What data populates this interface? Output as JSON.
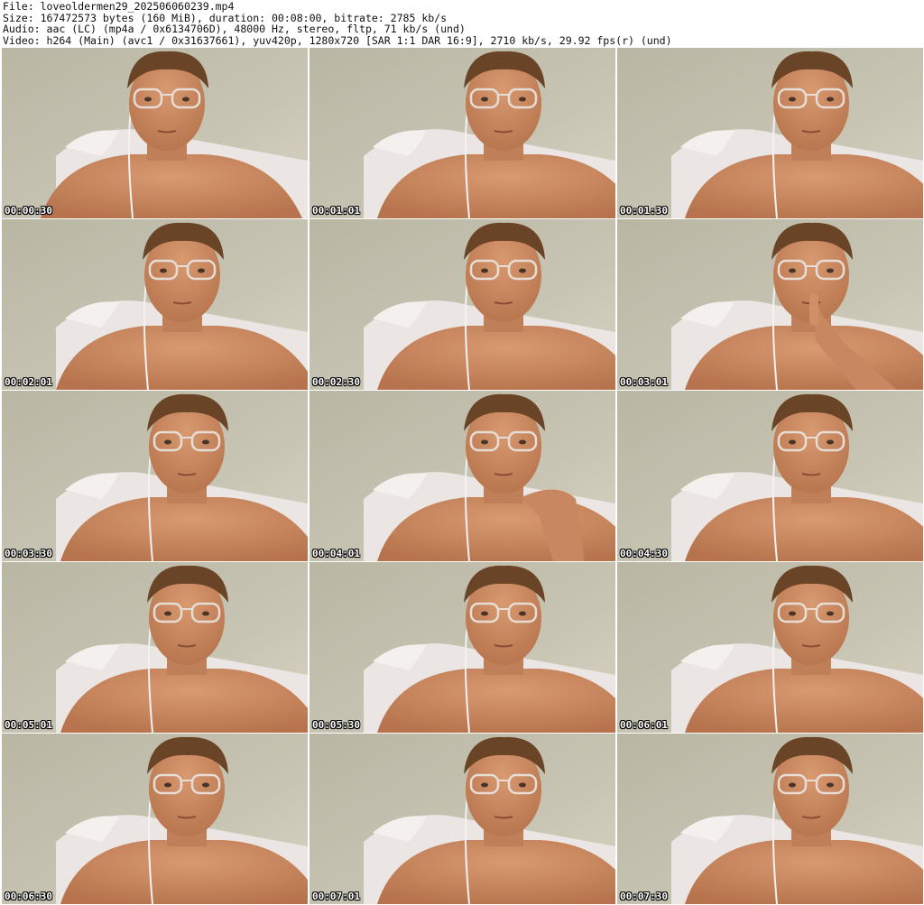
{
  "header": {
    "file_line": "File: loveoldermen29_202506060239.mp4",
    "size_line": "Size: 167472573 bytes (160 MiB), duration: 00:08:00, bitrate: 2785 kb/s",
    "audio_line": "Audio: aac (LC) (mp4a / 0x6134706D), 48000 Hz, stereo, fltp, 71 kb/s (und)",
    "video_line": "Video: h264 (Main) (avc1 / 0x31637661), yuv420p, 1280x720 [SAR 1:1 DAR 16:9], 2710 kb/s, 29.92 fps(r) (und)"
  },
  "thumbnails": [
    {
      "timestamp": "00:00:30"
    },
    {
      "timestamp": "00:01:01"
    },
    {
      "timestamp": "00:01:30"
    },
    {
      "timestamp": "00:02:01"
    },
    {
      "timestamp": "00:02:30"
    },
    {
      "timestamp": "00:03:01"
    },
    {
      "timestamp": "00:03:30"
    },
    {
      "timestamp": "00:04:01"
    },
    {
      "timestamp": "00:04:30"
    },
    {
      "timestamp": "00:05:01"
    },
    {
      "timestamp": "00:05:30"
    },
    {
      "timestamp": "00:06:01"
    },
    {
      "timestamp": "00:06:30"
    },
    {
      "timestamp": "00:07:01"
    },
    {
      "timestamp": "00:07:30"
    }
  ],
  "colors": {
    "wall": "#c8c4b3",
    "pillow": "#ebe5e3",
    "skin": "#c98a62",
    "hair": "#6a4426",
    "timestamp_text": "#ffffff"
  }
}
